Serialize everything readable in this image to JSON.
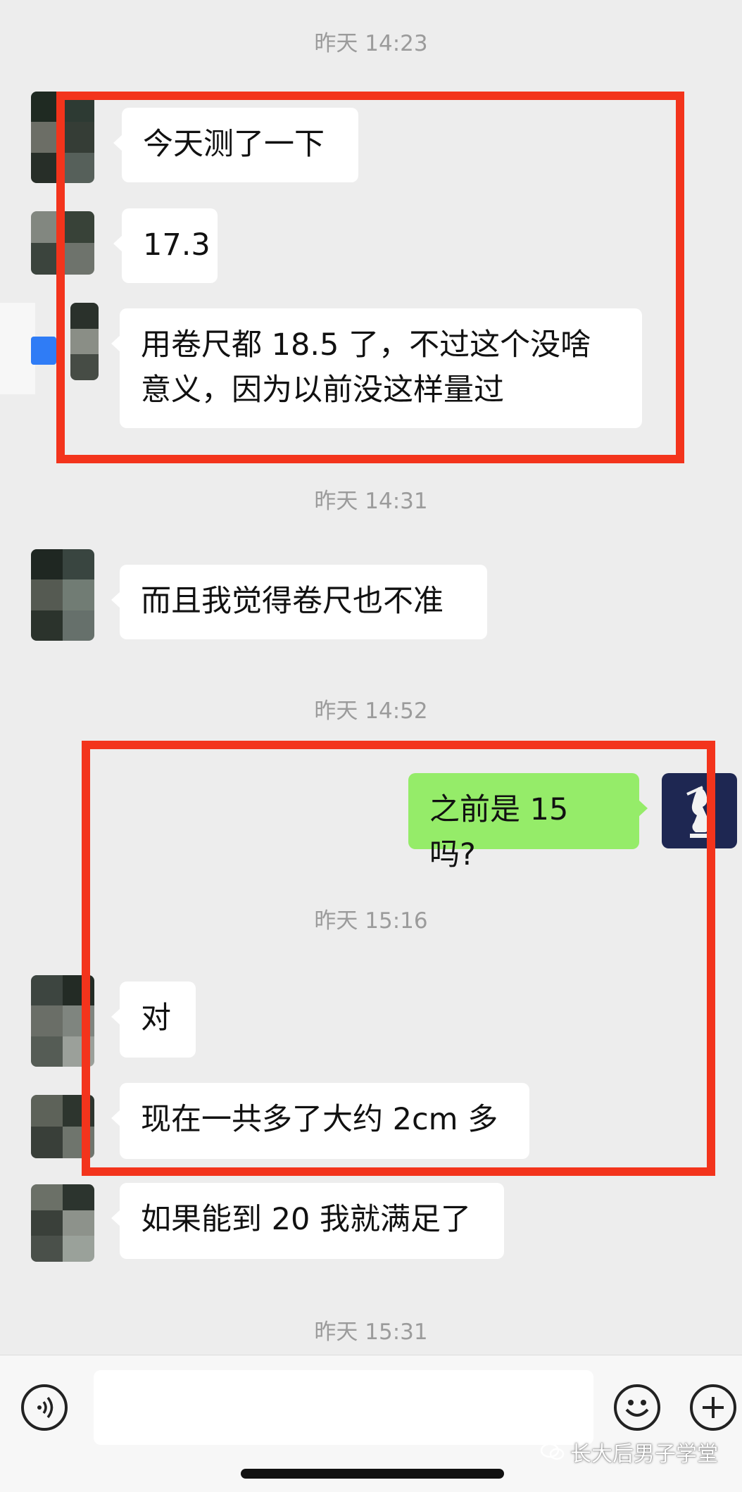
{
  "timestamps": [
    "昨天 14:23",
    "昨天 14:31",
    "昨天 14:52",
    "昨天 15:16",
    "昨天 15:31"
  ],
  "messages": [
    {
      "side": "left",
      "text": "今天测了一下"
    },
    {
      "side": "left",
      "text": "17.3"
    },
    {
      "side": "left",
      "text": "用卷尺都 18.5 了，不过这个没啥\n意义，因为以前没这样量过"
    },
    {
      "side": "left",
      "text": "而且我觉得卷尺也不准"
    },
    {
      "side": "right",
      "text": "之前是 15 吗?"
    },
    {
      "side": "left",
      "text": "对"
    },
    {
      "side": "left",
      "text": "现在一共多了大约 2cm 多"
    },
    {
      "side": "left",
      "text": "如果能到 20 我就满足了"
    }
  ],
  "input_bar": {
    "voice_icon": "voice-icon",
    "emoji_icon": "emoji-icon",
    "add_icon": "plus-icon"
  },
  "watermark": {
    "text": "长大后男子学堂",
    "icon": "wechat-icon"
  },
  "colors": {
    "background": "#ededed",
    "incoming_bubble": "#ffffff",
    "outgoing_bubble": "#95ec69",
    "highlight_box": "#f3341c",
    "timestamp": "#9b9b9b"
  }
}
